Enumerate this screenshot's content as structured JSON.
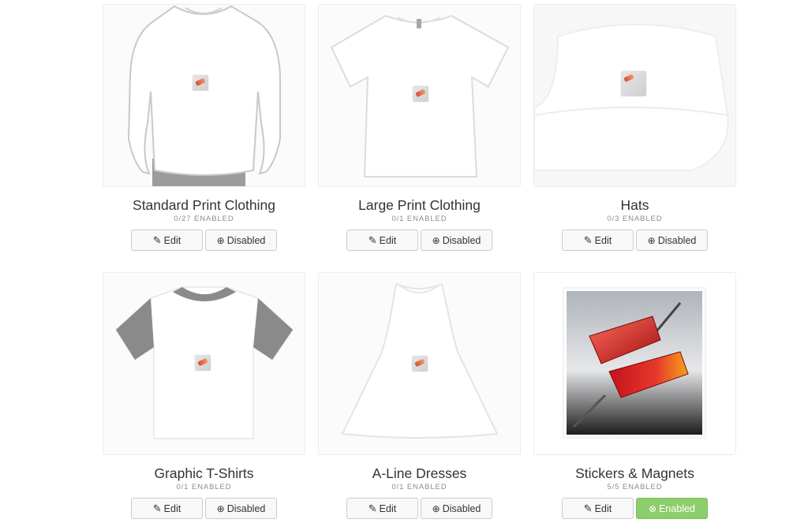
{
  "products": [
    {
      "title": "Standard Print Clothing",
      "enabled": "0/27 ENABLED",
      "edit_label": "Edit",
      "state_label": "Disabled",
      "state": "disabled",
      "image": "tshirt-on-model"
    },
    {
      "title": "Large Print Clothing",
      "enabled": "0/1 ENABLED",
      "edit_label": "Edit",
      "state_label": "Disabled",
      "state": "disabled",
      "image": "tshirt-flat"
    },
    {
      "title": "Hats",
      "enabled": "0/3 ENABLED",
      "edit_label": "Edit",
      "state_label": "Disabled",
      "state": "disabled",
      "image": "bucket-hat"
    },
    {
      "title": "Graphic T-Shirts",
      "enabled": "0/1 ENABLED",
      "edit_label": "Edit",
      "state_label": "Disabled",
      "state": "disabled",
      "image": "graphic-tshirt"
    },
    {
      "title": "A-Line Dresses",
      "enabled": "0/1 ENABLED",
      "edit_label": "Edit",
      "state_label": "Disabled",
      "state": "disabled",
      "image": "a-line-dress"
    },
    {
      "title": "Stickers & Magnets",
      "enabled": "5/5 ENABLED",
      "edit_label": "Edit",
      "state_label": "Enabled",
      "state": "enabled",
      "image": "sticker"
    }
  ],
  "icons": {
    "edit": "✎",
    "disabled": "⊕",
    "enabled": "⊗"
  },
  "colors": {
    "enabled_green": "#8dcd6b",
    "border": "#cccccc",
    "muted": "#8c8c8c"
  }
}
